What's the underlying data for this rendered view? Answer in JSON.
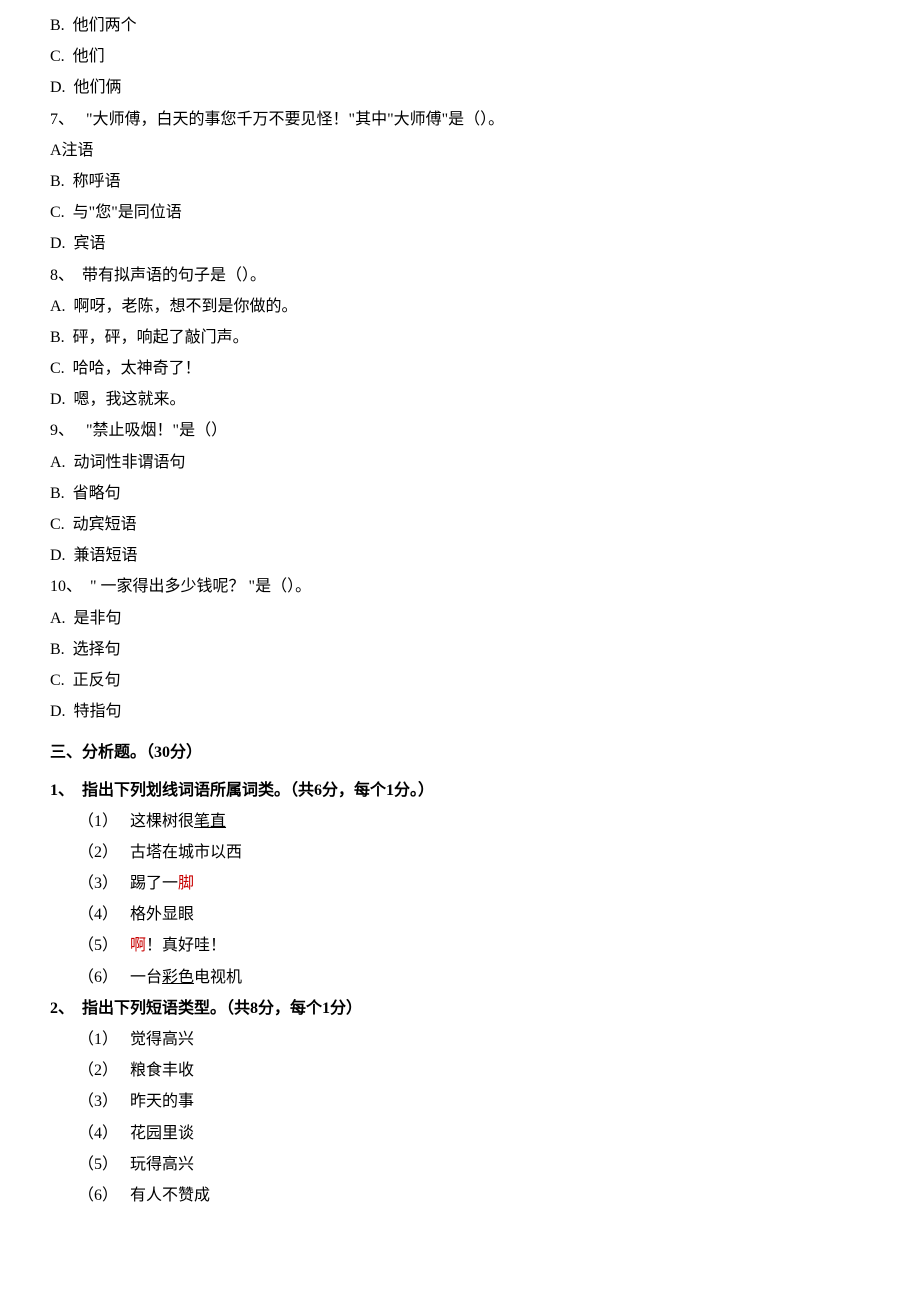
{
  "q6": {
    "optB": "B.  他们两个",
    "optC": "C.  他们",
    "optD": "D.  他们俩"
  },
  "q7": {
    "prompt": "7、   \"大师傅，白天的事您千万不要见怪！\"其中\"大师傅\"是（）。",
    "optA": "A注语",
    "optB": "B.  称呼语",
    "optC": "C.  与\"您\"是同位语",
    "optD": "D.  宾语"
  },
  "q8": {
    "prompt": "8、  带有拟声语的句子是（）。",
    "optA": "A.  啊呀，老陈，想不到是你做的。",
    "optB": "B.  砰，砰，响起了敲门声。",
    "optC": "C.  哈哈，太神奇了！",
    "optD": "D.  嗯，我这就来。"
  },
  "q9": {
    "prompt": "9、   \"禁止吸烟！\"是（）",
    "optA": "A.  动词性非谓语句",
    "optB": "B.  省略句",
    "optC": "C.  动宾短语",
    "optD": "D.  兼语短语"
  },
  "q10": {
    "prompt": "10、  \" 一家得出多少钱呢？ \"是（）。",
    "optA": "A.  是非句",
    "optB": "B.  选择句",
    "optC": "C.  正反句",
    "optD": "D.  特指句"
  },
  "section3": {
    "heading": "三、分析题。（30分）",
    "p1": {
      "prompt": "1、  指出下列划线词语所属词类。（共6分，每个1分。）",
      "i1_pre": "（1）   这棵树很",
      "i1_u": "笔直",
      "i2": "（2）   古塔在城市以西",
      "i3_pre": "（3）   踢了一",
      "i3_red": "脚",
      "i4": "（4）   格外显眼",
      "i5_pre": "（5）   ",
      "i5_red": "啊",
      "i5_post": "！真好哇！",
      "i6_pre": "（6）   一台",
      "i6_u": "彩色",
      "i6_post": "电视机"
    },
    "p2": {
      "prompt": "2、  指出下列短语类型。（共8分，每个1分）",
      "i1": "（1）   觉得高兴",
      "i2": "（2）   粮食丰收",
      "i3": "（3）   昨天的事",
      "i4": "（4）   花园里谈",
      "i5": "（5）   玩得高兴",
      "i6": "（6）   有人不赞成"
    }
  }
}
